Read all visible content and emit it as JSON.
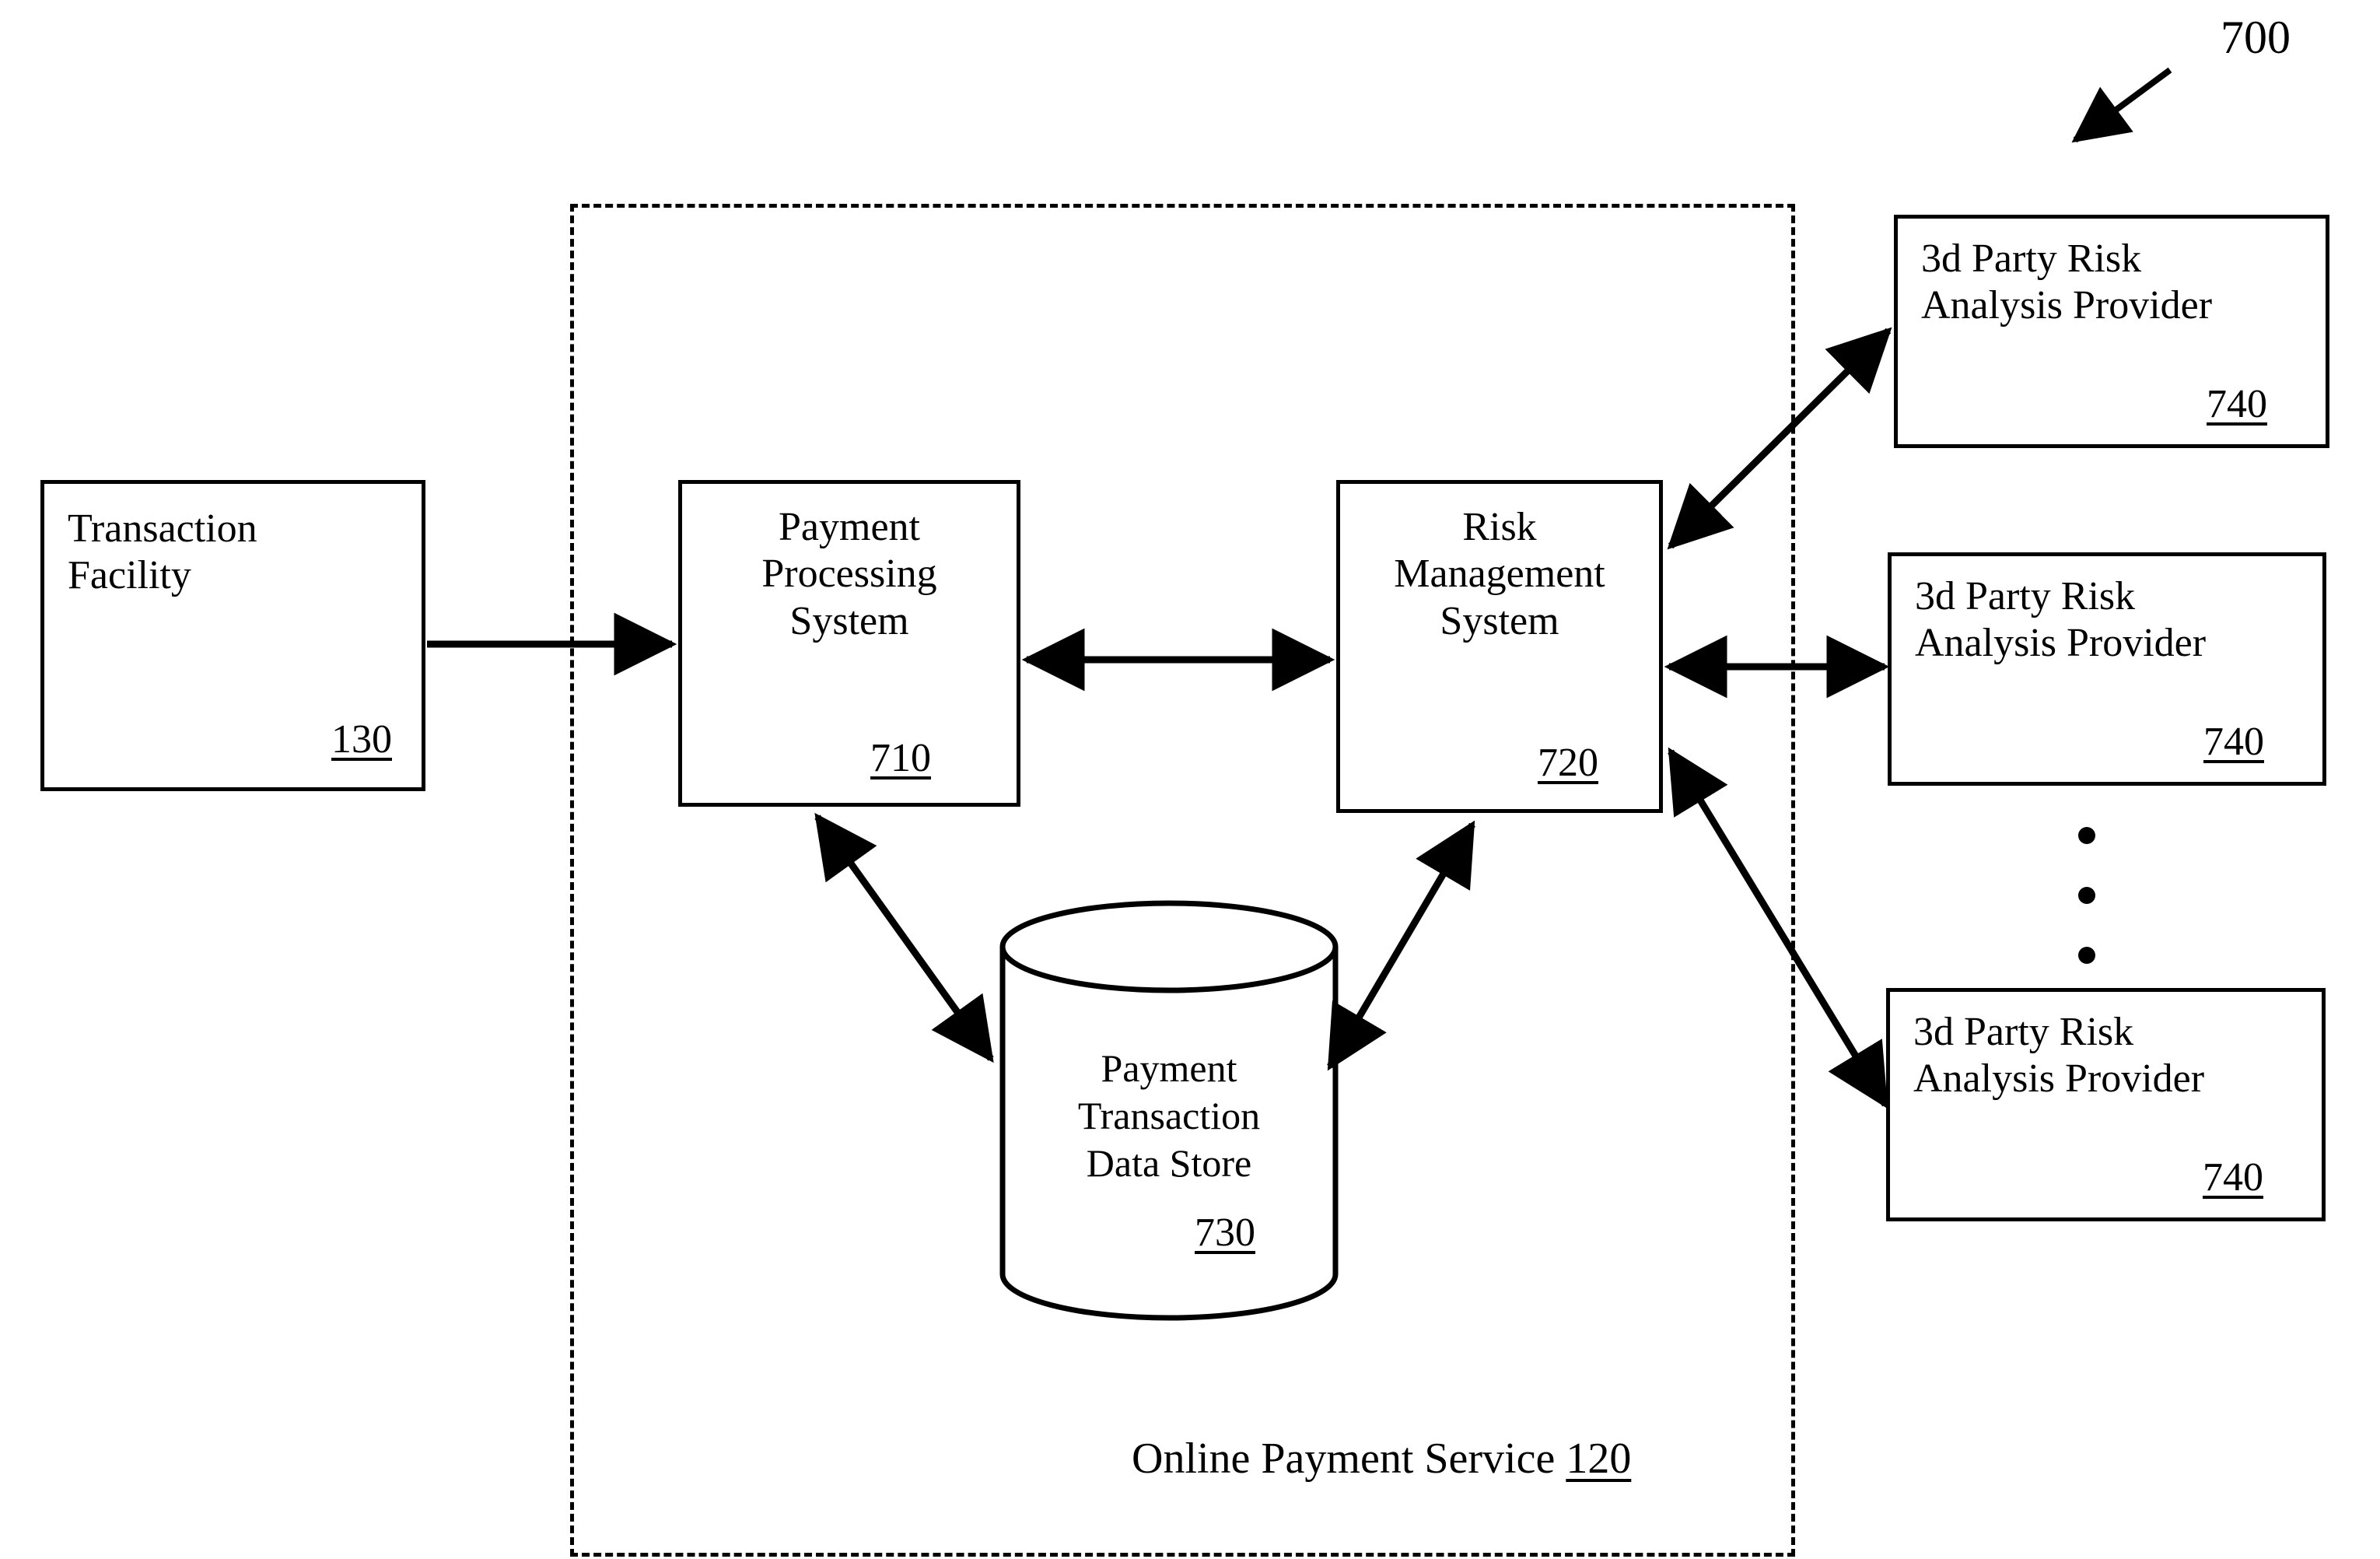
{
  "figure": {
    "number": "700",
    "callout_icon": "diagonal-arrow-icon"
  },
  "boundary": {
    "label_text": "Online Payment Service",
    "label_ref": "120",
    "style": "dashed"
  },
  "nodes": {
    "transaction_facility": {
      "line1": "Transaction",
      "line2": "Facility",
      "ref": "130"
    },
    "payment_processing": {
      "line1": "Payment",
      "line2": "Processing",
      "line3": "System",
      "ref": "710"
    },
    "risk_management": {
      "line1": "Risk",
      "line2": "Management",
      "line3": "System",
      "ref": "720"
    },
    "data_store": {
      "line1": "Payment",
      "line2": "Transaction",
      "line3": "Data Store",
      "ref": "730",
      "shape": "cylinder"
    },
    "providers": [
      {
        "line1": "3d Party Risk",
        "line2": "Analysis Provider",
        "ref": "740"
      },
      {
        "line1": "3d Party Risk",
        "line2": "Analysis Provider",
        "ref": "740"
      },
      {
        "line1": "3d Party Risk",
        "line2": "Analysis Provider",
        "ref": "740"
      }
    ]
  },
  "ellipsis": {
    "dots": 3,
    "orientation": "vertical",
    "meaning": "additional-providers"
  },
  "connectors": [
    {
      "name": "transaction-facility-to-payment-processing",
      "from": "transaction_facility",
      "to": "payment_processing",
      "heads": "single"
    },
    {
      "name": "payment-processing-to-risk-management",
      "from": "payment_processing",
      "to": "risk_management",
      "heads": "double"
    },
    {
      "name": "payment-processing-to-data-store",
      "from": "payment_processing",
      "to": "data_store",
      "heads": "double"
    },
    {
      "name": "data-store-to-risk-management",
      "from": "data_store",
      "to": "risk_management",
      "heads": "double"
    },
    {
      "name": "risk-management-to-provider-1",
      "from": "risk_management",
      "to": "provider_1",
      "heads": "double"
    },
    {
      "name": "risk-management-to-provider-2",
      "from": "risk_management",
      "to": "provider_2",
      "heads": "double"
    },
    {
      "name": "risk-management-to-provider-3",
      "from": "risk_management",
      "to": "provider_3",
      "heads": "double"
    }
  ],
  "colors": {
    "stroke": "#000000",
    "background": "#ffffff"
  }
}
